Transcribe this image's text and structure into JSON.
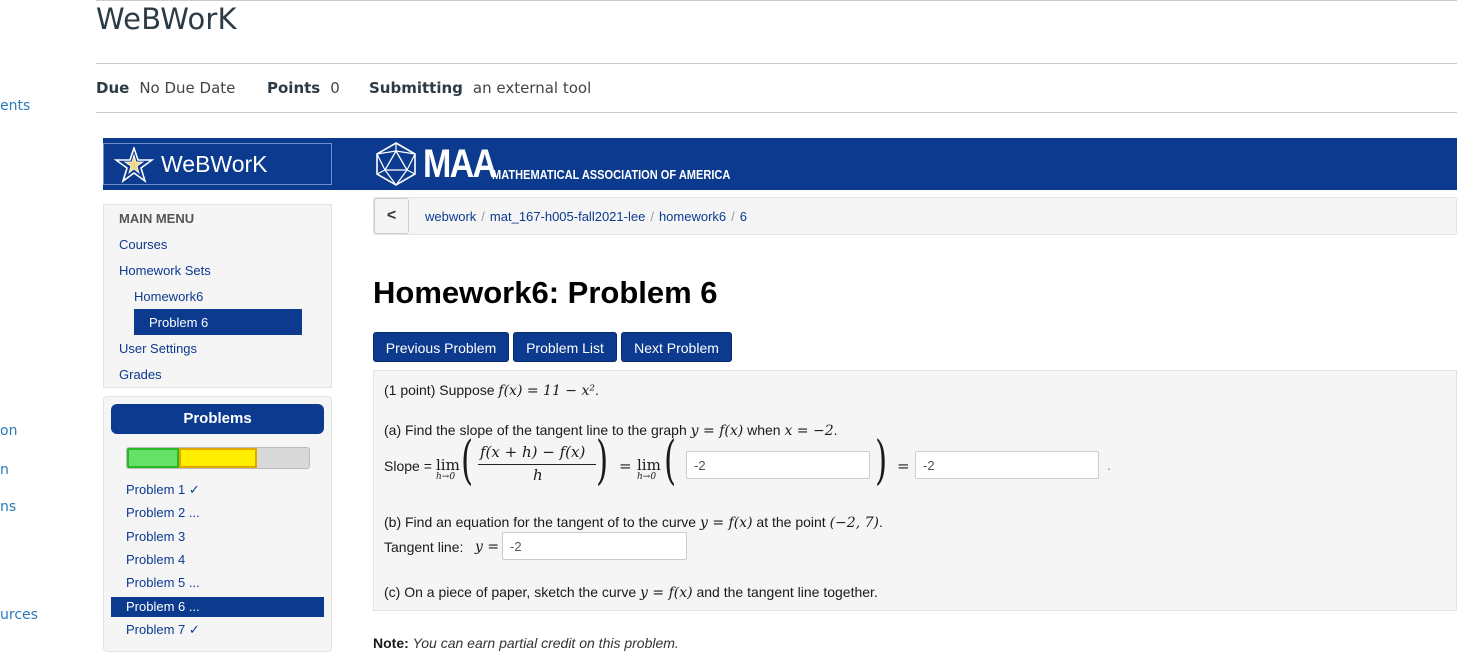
{
  "canvas": {
    "left_nav_fragments": [
      "ents",
      "on",
      "n",
      "ns",
      "urces"
    ],
    "title": "WeBWorK",
    "meta": {
      "due_label": "Due",
      "due_value": "No Due Date",
      "points_label": "Points",
      "points_value": "0",
      "submitting_label": "Submitting",
      "submitting_value": "an external tool"
    }
  },
  "banner": {
    "webwork_logo_text": "WeBWorK",
    "maa_logo_text": "MAA",
    "maa_subtitle": "MATHEMATICAL ASSOCIATION OF AMERICA"
  },
  "main_menu": {
    "heading": "MAIN MENU",
    "items": [
      "Courses",
      "Homework Sets",
      "Homework6",
      "Problem 6",
      "User Settings",
      "Grades"
    ]
  },
  "problems_panel": {
    "heading": "Problems",
    "progress": {
      "correct_fraction": 0.286,
      "partial_fraction": 0.43
    },
    "items": [
      {
        "label": "Problem 1 ✓"
      },
      {
        "label": "Problem 2 ..."
      },
      {
        "label": "Problem 3"
      },
      {
        "label": "Problem 4"
      },
      {
        "label": "Problem 5 ..."
      },
      {
        "label": "Problem 6 ..."
      },
      {
        "label": "Problem 7 ✓"
      }
    ]
  },
  "breadcrumb": {
    "back": "<",
    "items": [
      "webwork",
      "mat_167-h005-fall2021-lee",
      "homework6",
      "6"
    ],
    "separator": "/"
  },
  "problem": {
    "title": "Homework6: Problem 6",
    "buttons": [
      "Previous Problem",
      "Problem List",
      "Next Problem"
    ],
    "intro_prefix": "(1 point) Suppose ",
    "intro_math": "f(x) = 11 − x²",
    "part_a_prefix": "(a) Find the slope of the tangent line to the graph ",
    "part_a_math1": "y = f(x)",
    "part_a_mid": " when ",
    "part_a_math2": "x = −2",
    "slope_label": "Slope = ",
    "lim": "lim",
    "lim_sub": "h→0",
    "numerator": "f(x + h) − f(x)",
    "denominator": "h",
    "equals": "=",
    "answer_inner": "-2",
    "answer_slope": "-2",
    "part_b_prefix": "(b) Find an equation for the tangent of to the curve ",
    "part_b_math1": "y = f(x)",
    "part_b_mid": " at the point ",
    "part_b_math2": "(−2, 7)",
    "tangent_label": "Tangent line:",
    "tangent_y": "y =",
    "answer_tangent": "-2",
    "part_c_prefix": "(c) On a piece of paper, sketch the curve ",
    "part_c_math": "y = f(x)",
    "part_c_suffix": " and the tangent line together.",
    "note_label": "Note:",
    "note_text": "You can earn partial credit on this problem."
  }
}
